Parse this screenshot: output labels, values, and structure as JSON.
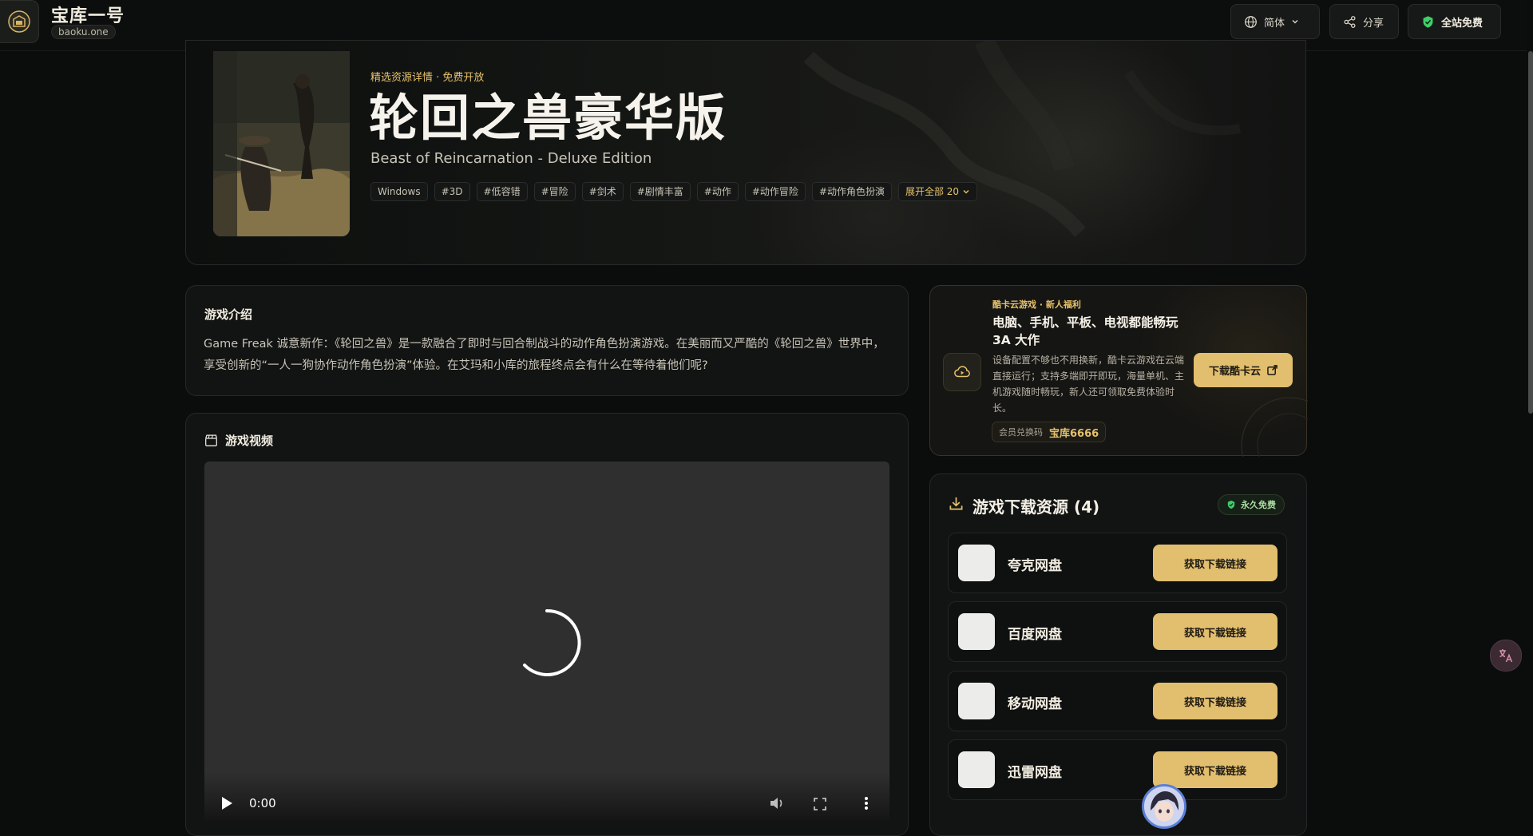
{
  "header": {
    "logo_title": "宝库一号",
    "logo_domain": "baoku.one",
    "lang_label": "简体",
    "share_label": "分享",
    "free_label": "全站免费"
  },
  "hero": {
    "meta": "精选资源详情 · 免费开放",
    "title": "轮回之兽豪华版",
    "subtitle": "Beast of Reincarnation - Deluxe Edition",
    "tags": [
      "Windows",
      "#3D",
      "#低容错",
      "#冒险",
      "#剑术",
      "#剧情丰富",
      "#动作",
      "#动作冒险",
      "#动作角色扮演"
    ],
    "expand_label": "展开全部 20"
  },
  "intro": {
    "heading": "游戏介绍",
    "text": "Game Freak 诚意新作：《轮回之兽》是一款融合了即时与回合制战斗的动作角色扮演游戏。在美丽而又严酷的《轮回之兽》世界中，享受创新的“一人一狗协作动作角色扮演”体验。在艾玛和小库的旅程终点会有什么在等待着他们呢?"
  },
  "video": {
    "heading": "游戏视频",
    "time": "0:00"
  },
  "cloud": {
    "meta": "酷卡云游戏 · 新人福利",
    "title": "电脑、手机、平板、电视都能畅玩 3A 大作",
    "desc": "设备配置不够也不用换新，酷卡云游戏在云端直接运行；支持多端即开即玩，海量单机、主机游戏随时畅玩，新人还可领取免费体验时长。",
    "code_label": "会员兑换码",
    "code_value": "宝库6666",
    "button_label": "下载酷卡云"
  },
  "downloads": {
    "title": "游戏下载资源 (4)",
    "badge": "永久免费",
    "items": [
      {
        "name": "夸克网盘",
        "button": "获取下载链接"
      },
      {
        "name": "百度网盘",
        "button": "获取下载链接"
      },
      {
        "name": "移动网盘",
        "button": "获取下载链接"
      },
      {
        "name": "迅雷网盘",
        "button": "获取下载链接"
      }
    ]
  },
  "colors": {
    "accent": "#e2be6f",
    "background": "#0b0d0c",
    "panel": "#121413",
    "success": "#a8dca0"
  },
  "icons": [
    "logo-icon",
    "globe-icon",
    "chevron-down-icon",
    "share-icon",
    "shield-check-icon",
    "clapperboard-icon",
    "cloud-play-icon",
    "external-link-icon",
    "download-icon",
    "play-icon",
    "volume-icon",
    "fullscreen-icon",
    "more-vertical-icon",
    "translate-icon"
  ]
}
